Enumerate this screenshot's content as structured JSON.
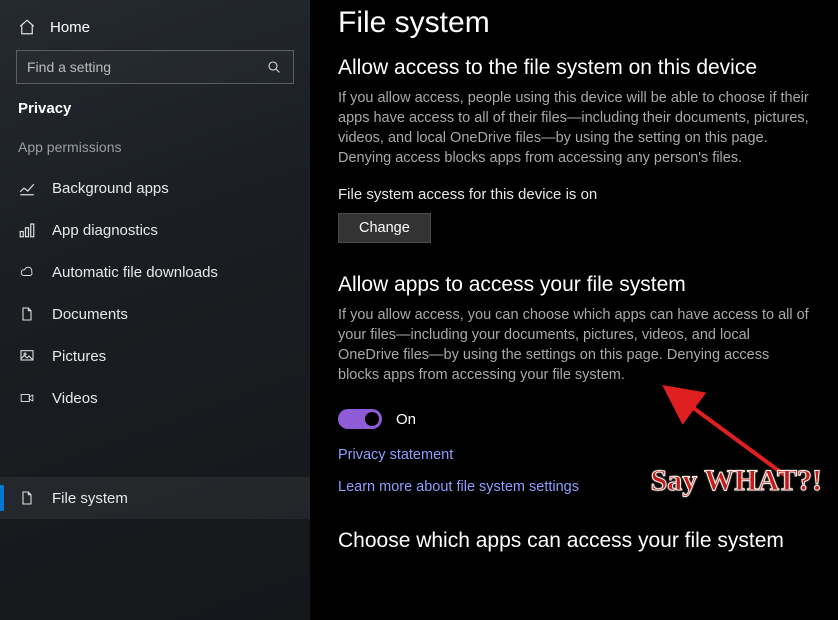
{
  "sidebar": {
    "home": "Home",
    "search_placeholder": "Find a setting",
    "category": "Privacy",
    "section": "App permissions",
    "items": [
      {
        "label": "Background apps"
      },
      {
        "label": "App diagnostics"
      },
      {
        "label": "Automatic file downloads"
      },
      {
        "label": "Documents"
      },
      {
        "label": "Pictures"
      },
      {
        "label": "Videos"
      }
    ],
    "selected": {
      "label": "File system"
    }
  },
  "main": {
    "title": "File system",
    "s1": {
      "heading": "Allow access to the file system on this device",
      "body": "If you allow access, people using this device will be able to choose if their apps have access to all of their files—including their documents, pictures, videos, and local OneDrive files—by using the setting on this page. Denying access blocks apps from accessing any person's files.",
      "status": "File system access for this device is on",
      "button": "Change"
    },
    "s2": {
      "heading": "Allow apps to access your file system",
      "body": "If you allow access, you can choose which apps can have access to all of your files—including your documents, pictures, videos, and local OneDrive files—by using the settings on this page. Denying access blocks apps from accessing your file system.",
      "toggle_state": "On",
      "link1": "Privacy statement",
      "link2": "Learn more about file system settings"
    },
    "s3": {
      "heading": "Choose which apps can access your file system"
    }
  },
  "annotation": {
    "text": "Say WHAT?!"
  }
}
